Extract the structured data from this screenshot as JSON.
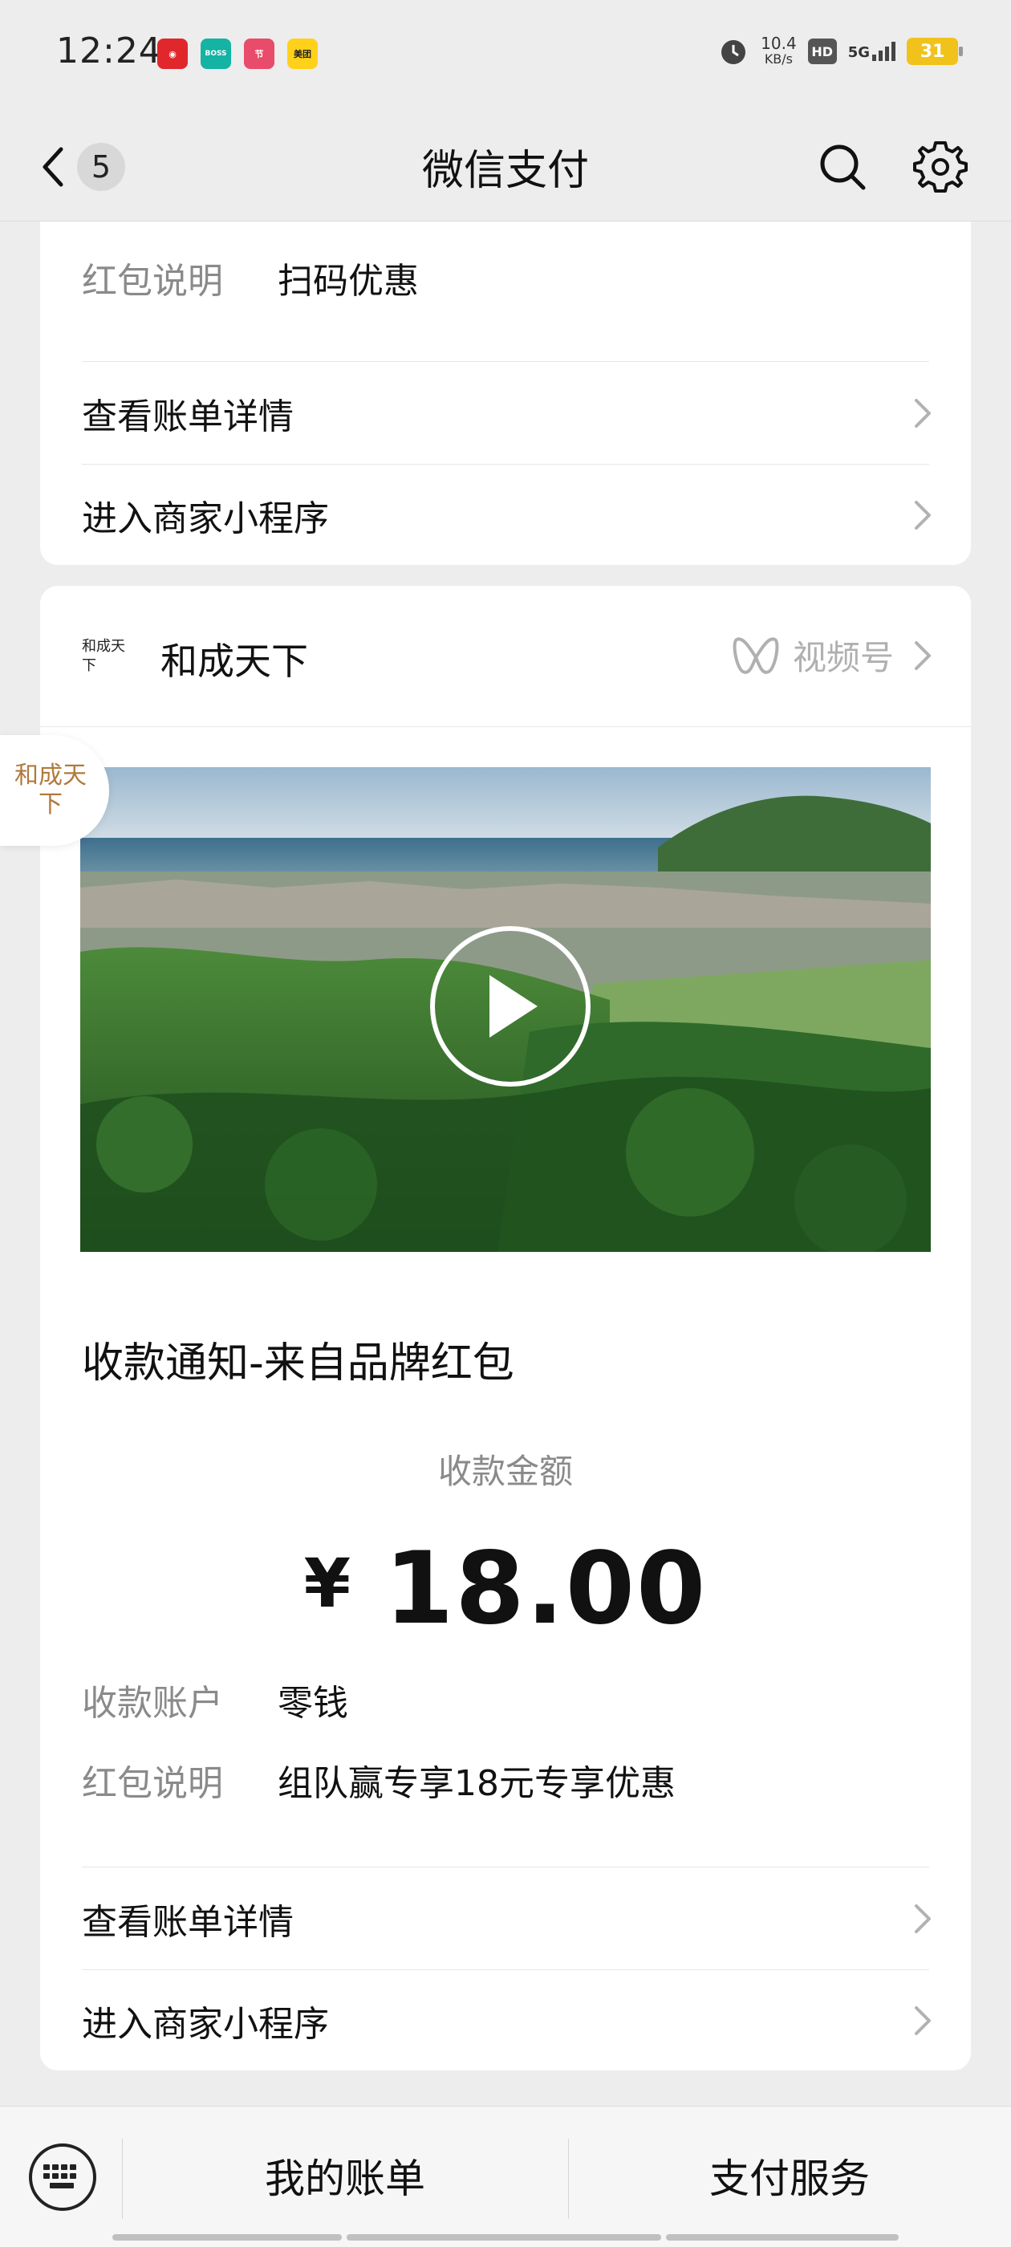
{
  "status_bar": {
    "time": "12:24",
    "apps": [
      {
        "name": "netease-music-icon",
        "color": "#e0272c",
        "text": "◉"
      },
      {
        "name": "boss-live-icon",
        "color": "#14b3a4",
        "text": "BOSS"
      },
      {
        "name": "festival-app-icon",
        "color": "#e94b6a",
        "text": "节"
      },
      {
        "name": "meituan-icon",
        "color": "#ffd11a",
        "text": "美团"
      }
    ],
    "speed_value": "10.4",
    "speed_unit": "KB/s",
    "hd": "HD",
    "network": "5G",
    "battery": "31"
  },
  "nav": {
    "back_count": "5",
    "title": "微信支付"
  },
  "card1": {
    "remark_label": "红包说明",
    "remark_value": "扫码优惠",
    "bill_link": "查看账单详情",
    "mini_program_link": "进入商家小程序"
  },
  "card2": {
    "brand_logo_text": "和成天下",
    "brand_name": "和成天下",
    "channels_label": "视频号",
    "notice_title": "收款通知-来自品牌红包",
    "amount_label": "收款金额",
    "currency": "¥",
    "amount": "18.00",
    "account_label": "收款账户",
    "account_value": "零钱",
    "remark_label": "红包说明",
    "remark_value": "组队赢专享18元专享优惠",
    "bill_link": "查看账单详情",
    "mini_program_link": "进入商家小程序"
  },
  "float_bubble_text": "和成天下",
  "bottom_bar": {
    "my_bills": "我的账单",
    "pay_services": "支付服务"
  },
  "colors": {
    "background": "#ededed",
    "card": "#ffffff",
    "muted_text": "#8a8a8a",
    "brand_accent": "#b07a3c"
  }
}
